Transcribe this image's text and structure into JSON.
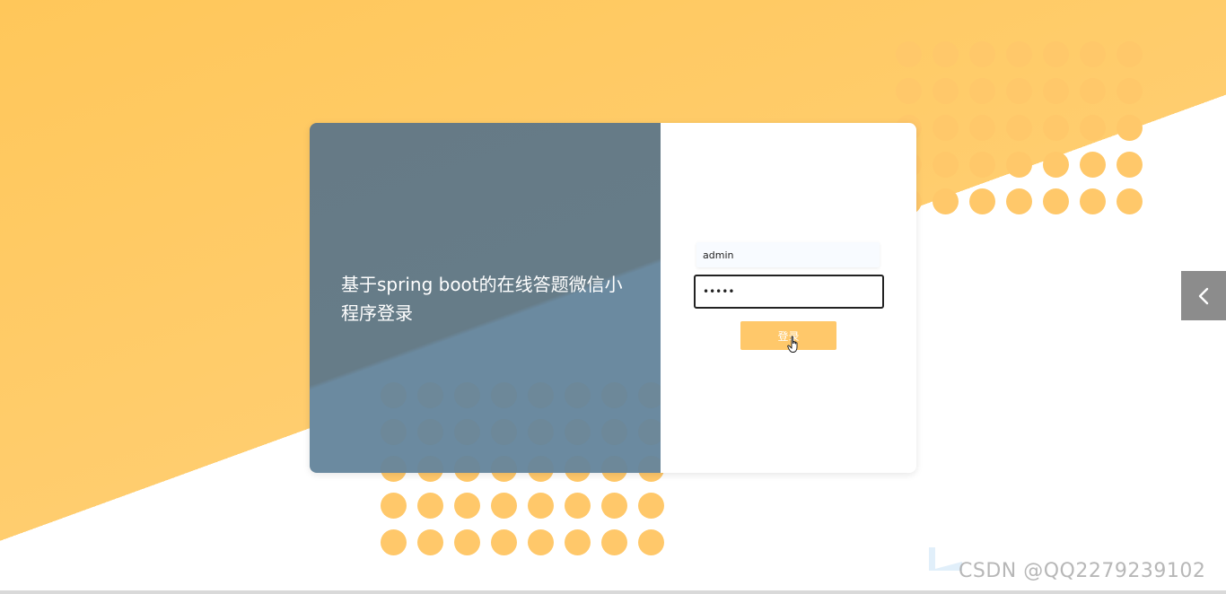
{
  "login": {
    "title": "基于spring boot的在线答题微信小程序登录",
    "username_value": "admin",
    "password_value": "•••••",
    "submit_label": "登录"
  },
  "watermark": {
    "text": "CSDN @QQ2279239102"
  },
  "colors": {
    "accent": "#ffc86a",
    "panel": "#667a86",
    "background": "#ffcd6e"
  },
  "icons": {
    "side_tab": "chevron-left-icon",
    "cursor": "hand-pointer-icon"
  }
}
